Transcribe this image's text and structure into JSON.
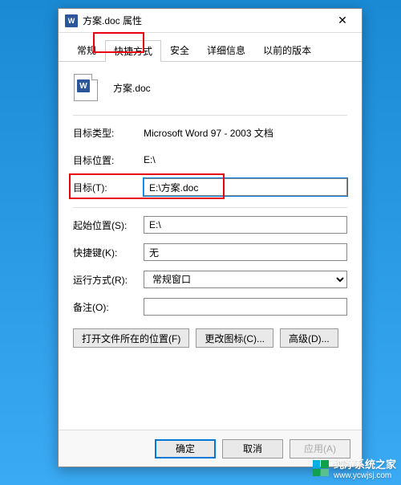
{
  "titlebar": {
    "icon_label": "W",
    "title": "方案.doc 属性",
    "close_label": "✕"
  },
  "tabs": {
    "general": "常规",
    "shortcut": "快捷方式",
    "security": "安全",
    "details": "详细信息",
    "previous": "以前的版本"
  },
  "file": {
    "name": "方案.doc"
  },
  "fields": {
    "target_type_label": "目标类型:",
    "target_type_value": "Microsoft Word 97 - 2003 文档",
    "target_location_label": "目标位置:",
    "target_location_value": "E:\\",
    "target_label": "目标(T):",
    "target_value": "E:\\方案.doc",
    "start_in_label": "起始位置(S):",
    "start_in_value": "E:\\",
    "shortcut_key_label": "快捷键(K):",
    "shortcut_key_value": "无",
    "run_label": "运行方式(R):",
    "run_value": "常规窗口",
    "comment_label": "备注(O):",
    "comment_value": ""
  },
  "buttons": {
    "open_location": "打开文件所在的位置(F)",
    "change_icon": "更改图标(C)...",
    "advanced": "高级(D)..."
  },
  "footer": {
    "ok": "确定",
    "cancel": "取消",
    "apply": "应用(A)"
  },
  "watermark": {
    "text": "纯净系统之家",
    "url": "www.ycwjsj.com"
  }
}
